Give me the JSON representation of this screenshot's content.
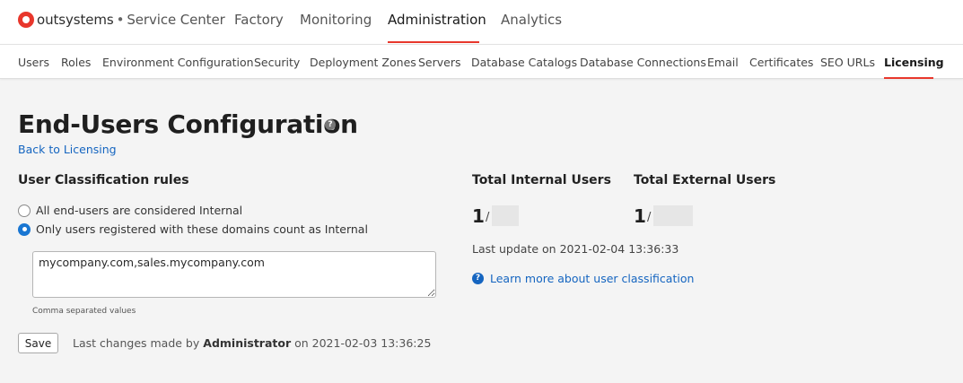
{
  "brand": {
    "name": "outsystems",
    "separator": "•",
    "product": "Service Center",
    "accent_color": "#e8372c"
  },
  "main_nav": [
    "Factory",
    "Monitoring",
    "Administration",
    "Analytics"
  ],
  "sub_nav": [
    "Users",
    "Roles",
    "Environment Configuration",
    "Security",
    "Deployment Zones",
    "Servers",
    "Database Catalogs",
    "Database Connections",
    "Email",
    "Certificates",
    "SEO URLs",
    "Licensing"
  ],
  "page": {
    "title": "End-Users Configuration",
    "help_icon": "help-icon",
    "back_link": "Back to Licensing"
  },
  "classification": {
    "heading": "User Classification rules",
    "option_all": "All end-users are considered Internal",
    "option_domains": "Only users registered with these domains count as Internal",
    "selected": "option_domains",
    "domains_value": "mycompany.com,sales.mycompany.com",
    "hint": "Comma separated values",
    "save_label": "Save",
    "last_changes_prefix": "Last changes made by",
    "last_changes_user": "Administrator",
    "last_changes_suffix": "on 2021-02-03 13:36:25"
  },
  "totals": {
    "internal_heading": "Total Internal Users",
    "internal_count": "1",
    "external_heading": "Total External Users",
    "external_count": "1",
    "slash": "/",
    "last_update": "Last update on 2021-02-04 13:36:33",
    "learn_more": "Learn more about user classification"
  }
}
